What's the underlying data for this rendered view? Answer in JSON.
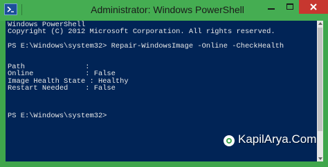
{
  "window": {
    "title": "Administrator: Windows PowerShell",
    "app_icon": "powershell-icon",
    "controls": {
      "minimize_icon": "minimize-icon",
      "maximize_icon": "maximize-icon",
      "close_icon": "close-icon"
    }
  },
  "console": {
    "lines": [
      "Windows PowerShell",
      "Copyright (C) 2012 Microsoft Corporation. All rights reserved.",
      "",
      "PS E:\\Windows\\system32> Repair-WindowsImage -Online -CheckHealth",
      "",
      "",
      "Path              :",
      "Online            : False",
      "Image Health State : Healthy",
      "Restart Needed    : False",
      "",
      "",
      "",
      "PS E:\\Windows\\system32>"
    ]
  },
  "watermark": {
    "text": "KapilArya.Com",
    "logo_icon": "kapilarya-logo-icon"
  },
  "colors": {
    "frame": "#3fa64c",
    "console_background": "#012456",
    "console_text": "#e8e8e8",
    "close_button": "#c7372f"
  }
}
